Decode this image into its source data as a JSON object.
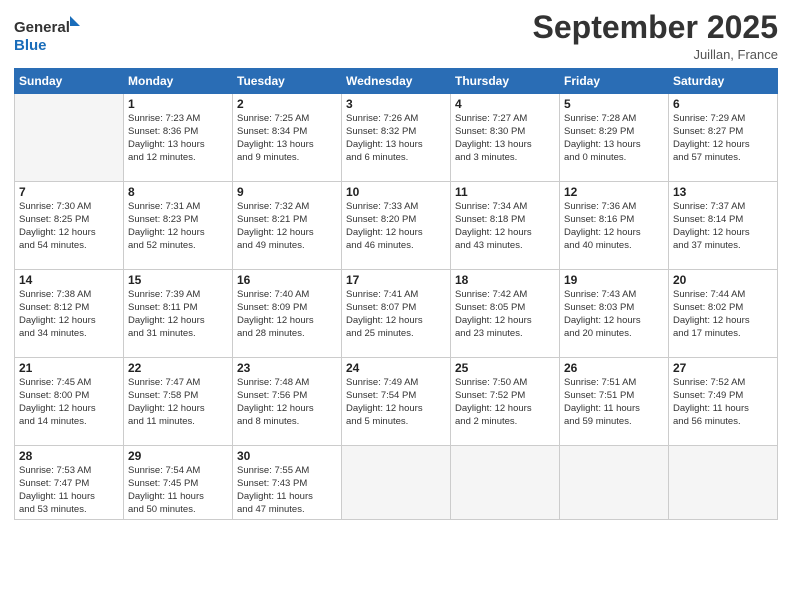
{
  "header": {
    "logo_line1": "General",
    "logo_line2": "Blue",
    "month": "September 2025",
    "location": "Juillan, France"
  },
  "weekdays": [
    "Sunday",
    "Monday",
    "Tuesday",
    "Wednesday",
    "Thursday",
    "Friday",
    "Saturday"
  ],
  "weeks": [
    [
      {
        "day": "",
        "info": ""
      },
      {
        "day": "1",
        "info": "Sunrise: 7:23 AM\nSunset: 8:36 PM\nDaylight: 13 hours\nand 12 minutes."
      },
      {
        "day": "2",
        "info": "Sunrise: 7:25 AM\nSunset: 8:34 PM\nDaylight: 13 hours\nand 9 minutes."
      },
      {
        "day": "3",
        "info": "Sunrise: 7:26 AM\nSunset: 8:32 PM\nDaylight: 13 hours\nand 6 minutes."
      },
      {
        "day": "4",
        "info": "Sunrise: 7:27 AM\nSunset: 8:30 PM\nDaylight: 13 hours\nand 3 minutes."
      },
      {
        "day": "5",
        "info": "Sunrise: 7:28 AM\nSunset: 8:29 PM\nDaylight: 13 hours\nand 0 minutes."
      },
      {
        "day": "6",
        "info": "Sunrise: 7:29 AM\nSunset: 8:27 PM\nDaylight: 12 hours\nand 57 minutes."
      }
    ],
    [
      {
        "day": "7",
        "info": "Sunrise: 7:30 AM\nSunset: 8:25 PM\nDaylight: 12 hours\nand 54 minutes."
      },
      {
        "day": "8",
        "info": "Sunrise: 7:31 AM\nSunset: 8:23 PM\nDaylight: 12 hours\nand 52 minutes."
      },
      {
        "day": "9",
        "info": "Sunrise: 7:32 AM\nSunset: 8:21 PM\nDaylight: 12 hours\nand 49 minutes."
      },
      {
        "day": "10",
        "info": "Sunrise: 7:33 AM\nSunset: 8:20 PM\nDaylight: 12 hours\nand 46 minutes."
      },
      {
        "day": "11",
        "info": "Sunrise: 7:34 AM\nSunset: 8:18 PM\nDaylight: 12 hours\nand 43 minutes."
      },
      {
        "day": "12",
        "info": "Sunrise: 7:36 AM\nSunset: 8:16 PM\nDaylight: 12 hours\nand 40 minutes."
      },
      {
        "day": "13",
        "info": "Sunrise: 7:37 AM\nSunset: 8:14 PM\nDaylight: 12 hours\nand 37 minutes."
      }
    ],
    [
      {
        "day": "14",
        "info": "Sunrise: 7:38 AM\nSunset: 8:12 PM\nDaylight: 12 hours\nand 34 minutes."
      },
      {
        "day": "15",
        "info": "Sunrise: 7:39 AM\nSunset: 8:11 PM\nDaylight: 12 hours\nand 31 minutes."
      },
      {
        "day": "16",
        "info": "Sunrise: 7:40 AM\nSunset: 8:09 PM\nDaylight: 12 hours\nand 28 minutes."
      },
      {
        "day": "17",
        "info": "Sunrise: 7:41 AM\nSunset: 8:07 PM\nDaylight: 12 hours\nand 25 minutes."
      },
      {
        "day": "18",
        "info": "Sunrise: 7:42 AM\nSunset: 8:05 PM\nDaylight: 12 hours\nand 23 minutes."
      },
      {
        "day": "19",
        "info": "Sunrise: 7:43 AM\nSunset: 8:03 PM\nDaylight: 12 hours\nand 20 minutes."
      },
      {
        "day": "20",
        "info": "Sunrise: 7:44 AM\nSunset: 8:02 PM\nDaylight: 12 hours\nand 17 minutes."
      }
    ],
    [
      {
        "day": "21",
        "info": "Sunrise: 7:45 AM\nSunset: 8:00 PM\nDaylight: 12 hours\nand 14 minutes."
      },
      {
        "day": "22",
        "info": "Sunrise: 7:47 AM\nSunset: 7:58 PM\nDaylight: 12 hours\nand 11 minutes."
      },
      {
        "day": "23",
        "info": "Sunrise: 7:48 AM\nSunset: 7:56 PM\nDaylight: 12 hours\nand 8 minutes."
      },
      {
        "day": "24",
        "info": "Sunrise: 7:49 AM\nSunset: 7:54 PM\nDaylight: 12 hours\nand 5 minutes."
      },
      {
        "day": "25",
        "info": "Sunrise: 7:50 AM\nSunset: 7:52 PM\nDaylight: 12 hours\nand 2 minutes."
      },
      {
        "day": "26",
        "info": "Sunrise: 7:51 AM\nSunset: 7:51 PM\nDaylight: 11 hours\nand 59 minutes."
      },
      {
        "day": "27",
        "info": "Sunrise: 7:52 AM\nSunset: 7:49 PM\nDaylight: 11 hours\nand 56 minutes."
      }
    ],
    [
      {
        "day": "28",
        "info": "Sunrise: 7:53 AM\nSunset: 7:47 PM\nDaylight: 11 hours\nand 53 minutes."
      },
      {
        "day": "29",
        "info": "Sunrise: 7:54 AM\nSunset: 7:45 PM\nDaylight: 11 hours\nand 50 minutes."
      },
      {
        "day": "30",
        "info": "Sunrise: 7:55 AM\nSunset: 7:43 PM\nDaylight: 11 hours\nand 47 minutes."
      },
      {
        "day": "",
        "info": ""
      },
      {
        "day": "",
        "info": ""
      },
      {
        "day": "",
        "info": ""
      },
      {
        "day": "",
        "info": ""
      }
    ]
  ]
}
